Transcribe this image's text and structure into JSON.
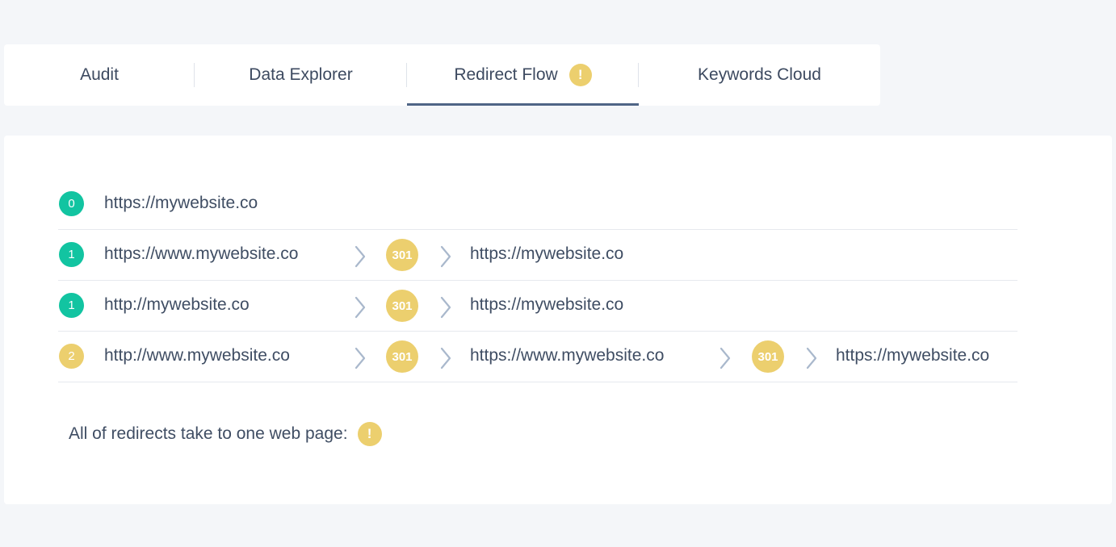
{
  "tabs": [
    {
      "label": "Audit"
    },
    {
      "label": "Data Explorer"
    },
    {
      "label": "Redirect Flow",
      "badge": "!",
      "active": true
    },
    {
      "label": "Keywords Cloud"
    }
  ],
  "redirects": [
    {
      "hops": "0",
      "hops_color": "green",
      "source": "https://mywebsite.co"
    },
    {
      "hops": "1",
      "hops_color": "green",
      "source": "https://www.mywebsite.co",
      "code1": "301",
      "target1": "https://mywebsite.co"
    },
    {
      "hops": "1",
      "hops_color": "green",
      "source": "http://mywebsite.co",
      "code1": "301",
      "target1": "https://mywebsite.co"
    },
    {
      "hops": "2",
      "hops_color": "yellow",
      "source": "http://www.mywebsite.co",
      "code1": "301",
      "target1": "https://www.mywebsite.co",
      "code2": "301",
      "target2": "https://mywebsite.co"
    }
  ],
  "summary": {
    "text": "All of redirects take to one web page:",
    "badge": "!"
  },
  "colors": {
    "green": "#12c4a1",
    "yellow": "#eccf6e",
    "accent": "#4f6586",
    "text": "#3f4d63"
  }
}
